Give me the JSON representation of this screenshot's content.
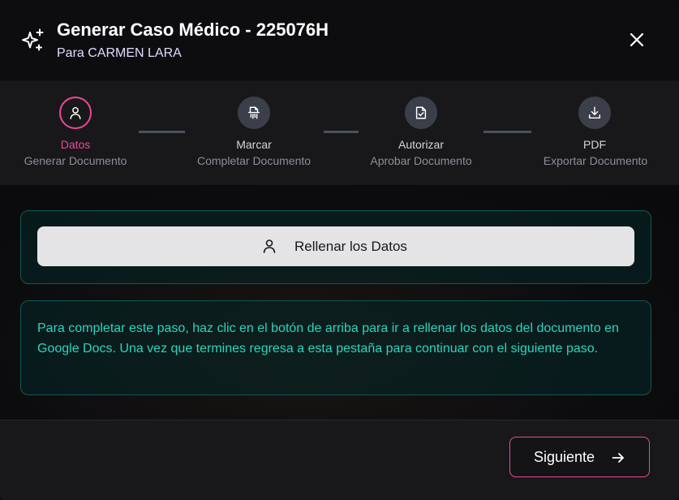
{
  "header": {
    "title": "Generar Caso Médico - 225076H",
    "subtitle": "Para CARMEN LARA",
    "icon": "sparkles-icon",
    "close_icon": "close-icon"
  },
  "stepper": {
    "steps": [
      {
        "name": "Datos",
        "description": "Generar Documento",
        "icon": "user-icon",
        "active": true
      },
      {
        "name": "Marcar",
        "description": "Completar Documento",
        "icon": "document-shred-icon",
        "active": false
      },
      {
        "name": "Autorizar",
        "description": "Aprobar Documento",
        "icon": "file-check-icon",
        "active": false
      },
      {
        "name": "PDF",
        "description": "Exportar Documento",
        "icon": "download-icon",
        "active": false
      }
    ]
  },
  "main": {
    "fill_button_label": "Rellenar los Datos",
    "fill_button_icon": "user-icon",
    "instructions": "Para completar este paso, haz clic en el botón de arriba para ir a rellenar los datos del documento en Google Docs. Una vez que termines regresa a esta pestaña para continuar con el siguiente paso."
  },
  "footer": {
    "next_label": "Siguiente",
    "next_icon": "arrow-right-icon"
  },
  "colors": {
    "accent": "#ec4899",
    "teal": "#2dd4bf",
    "panel": "#18181b",
    "inactive_step": "#3a3f4a"
  }
}
